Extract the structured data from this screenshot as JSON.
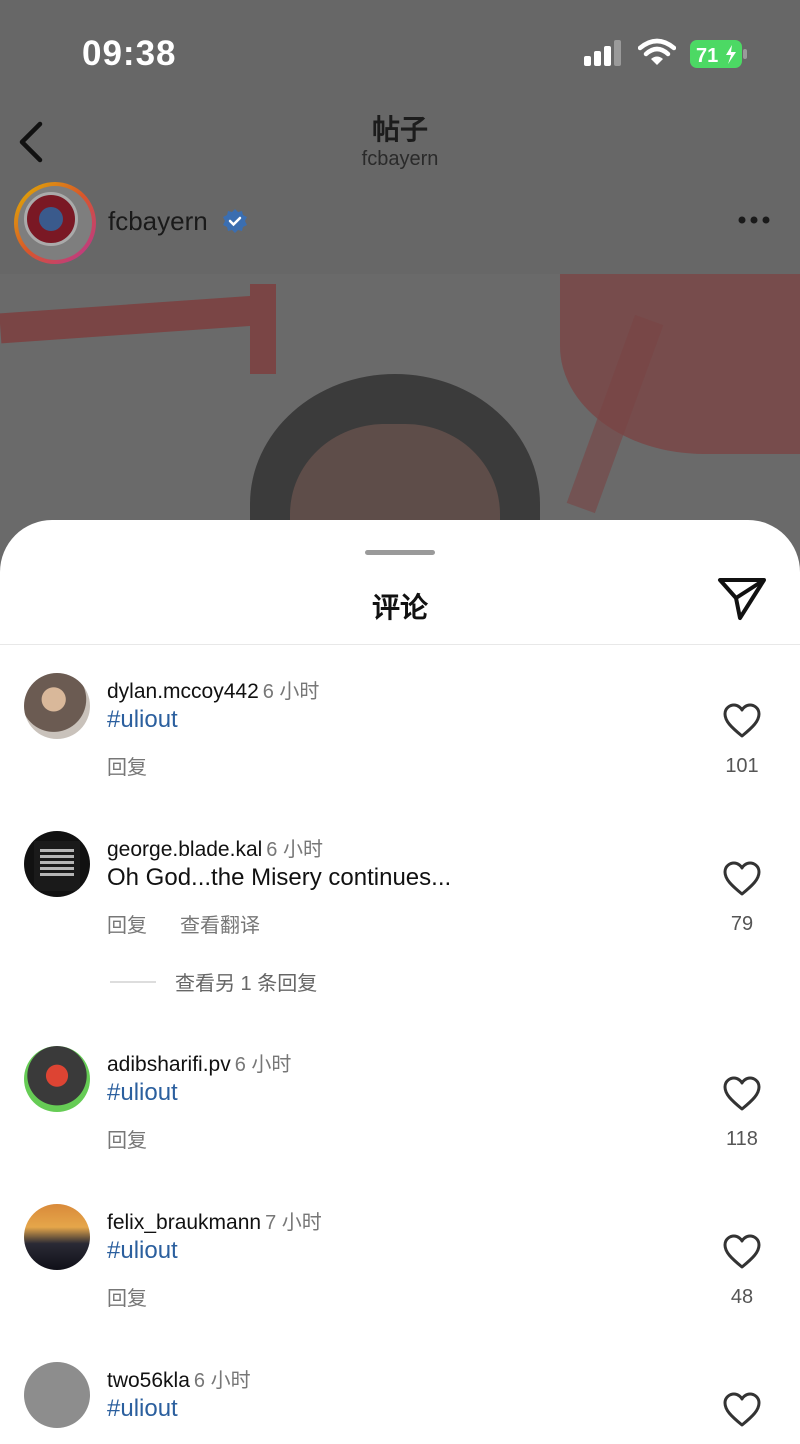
{
  "status_bar": {
    "time": "09:38",
    "battery": "71"
  },
  "nav": {
    "title": "帖子",
    "subtitle": "fcbayern"
  },
  "post": {
    "username": "fcbayern"
  },
  "sheet": {
    "title": "评论"
  },
  "comments": [
    {
      "user": "dylan.mccoy442",
      "time": "6 小时",
      "text": "#uliout",
      "is_tag": true,
      "reply": "回复",
      "likes": "101"
    },
    {
      "user": "george.blade.kal",
      "time": "6 小时",
      "text": "Oh God...the Misery continues...",
      "is_tag": false,
      "reply": "回复",
      "translate": "查看翻译",
      "likes": "79",
      "more_replies": "查看另 1 条回复"
    },
    {
      "user": "adibsharifi.pv",
      "time": "6 小时",
      "text": "#uliout",
      "is_tag": true,
      "reply": "回复",
      "likes": "118"
    },
    {
      "user": "felix_braukmann",
      "time": "7 小时",
      "text": "#uliout",
      "is_tag": true,
      "reply": "回复",
      "likes": "48"
    },
    {
      "user": "two56kla",
      "time": "6 小时",
      "text": "#uliout",
      "is_tag": true
    }
  ],
  "icons": [
    "back-icon",
    "verified-icon",
    "more-icon",
    "send-icon",
    "heart-icon",
    "signal-icon",
    "wifi-icon",
    "battery-icon"
  ],
  "colors": {
    "hashtag": "#2b5f9e",
    "battery": "#4cd964",
    "verified": "#3b82f6"
  }
}
